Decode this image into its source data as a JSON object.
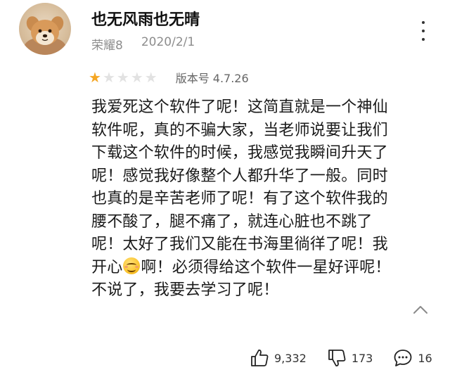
{
  "review": {
    "username": "也无风雨也无晴",
    "device": "荣耀8",
    "date": "2020/2/1",
    "rating": 1,
    "rating_max": 5,
    "version_label": "版本号 4.7.26",
    "lines": [
      "我爱死这个软件了呢！这简直就是一个神仙",
      "软件呢，真的不骗大家，当老师说要让我们",
      "下载这个软件的时候，我感觉我瞬间升天了",
      "呢！感觉我好像整个人都升华了一般。同时",
      "也真的是辛苦老师了呢！有了这个软件我的",
      "腰不酸了，腿不痛了，就连心脏也不跳了",
      "呢！太好了我们又能在书海里徜徉了呢！我"
    ],
    "line_emoji_before": "开心",
    "line_emoji_after": "啊！必须得给这个软件一星好评呢！",
    "last_line": "不说了，我要去学习了呢！"
  },
  "actions": {
    "likes": "9,332",
    "dislikes": "173",
    "comments": "16"
  },
  "icons": {
    "more": "more-vertical-icon",
    "collapse": "chevron-up-icon",
    "like": "thumbs-up-icon",
    "dislike": "thumbs-down-icon",
    "comment": "comment-icon",
    "emoji": "smiling-face-emoji"
  },
  "colors": {
    "star_filled": "#f5a623",
    "star_empty": "#e2e2e2",
    "meta_text": "#8d8d8d"
  }
}
